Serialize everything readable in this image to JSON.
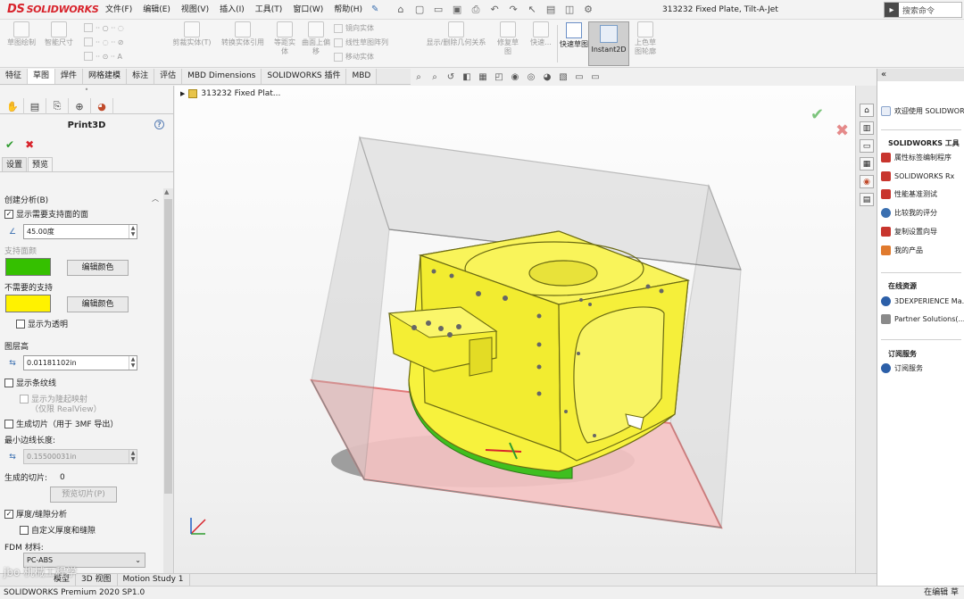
{
  "app": {
    "logo_text": "SOLIDWORKS",
    "document_title": "313232 Fixed Plate, Tilt-A-Jet",
    "search_placeholder": "搜索命令"
  },
  "menu": [
    "文件(F)",
    "编辑(E)",
    "视图(V)",
    "插入(I)",
    "工具(T)",
    "窗口(W)",
    "帮助(H)"
  ],
  "commands": {
    "sketch": "草图绘制",
    "smart_dim": "智能尺寸",
    "trim": "剪裁实体(T)",
    "convert": "转换实体引用",
    "offset": "等距实体",
    "surface_offset": "曲面上偏移",
    "mirror": "镜向实体",
    "linear_pattern": "线性草图阵列",
    "move": "移动实体",
    "show_relations": "显示/删除几何关系",
    "repair": "修复草图",
    "quick_snap": "快速...",
    "rapid_sketch": "快速草图",
    "instant2d": "Instant2D",
    "shaded_sketch": "上色草图轮廓"
  },
  "tabs": [
    "特征",
    "草图",
    "焊件",
    "网格建模",
    "标注",
    "评估",
    "MBD Dimensions",
    "SOLIDWORKS 插件",
    "MBD"
  ],
  "active_tab_index": 1,
  "property_manager": {
    "title": "Print3D",
    "subtabs": [
      "设置",
      "预览"
    ],
    "active_subtab_index": 1,
    "create_analysis_title": "创建分析(B)",
    "show_support_faces": "显示需要支持面的面",
    "angle_value": "45.00度",
    "support_faces_label": "支持面颜",
    "edit_color_label": "编辑颜色",
    "no_support_label": "不需要的支持",
    "show_transparent": "显示为透明",
    "layer_height_title": "图层高",
    "layer_height_value": "0.01181102in",
    "show_stripes": "显示条纹线",
    "show_as_bump": "显示为隆起映射",
    "realview_note": "（仅限 RealView）",
    "generate_slices": "生成切片（用于 3MF 导出）",
    "min_edge_title": "最小边线长度:",
    "min_edge_value": "0.15500031in",
    "slices_label": "生成的切片:",
    "slices_count": "0",
    "preview_slices_btn": "预览切片(P)",
    "thickness_analysis": "厚度/缝隙分析",
    "custom_thickness": "自定义厚度和缝隙",
    "fdm_material_label": "FDM 材料:",
    "fdm_material_value": "PC-ABS",
    "support_color": "#35c000",
    "no_support_color": "#fff200"
  },
  "viewport": {
    "tree_label": "313232 Fixed Plat...",
    "part_color": "#f7f23d",
    "support_face_color": "#3fbf1f",
    "build_plate_color": "#f3b2b2"
  },
  "taskpane": {
    "welcome": "欢迎使用 SOLIDWORKS",
    "tools_title": "SOLIDWORKS 工具",
    "tools": [
      "属性标签编制程序",
      "SOLIDWORKS Rx",
      "性能基准测试",
      "比较我的评分",
      "复制设置向导",
      "我的产品"
    ],
    "online_title": "在线资源",
    "online": [
      "3DEXPERIENCE Ma...",
      "Partner Solutions(..."
    ],
    "subscription_title": "订阅服务",
    "subscription": [
      "订阅服务"
    ]
  },
  "bottom_tabs": [
    "模型",
    "3D 视图",
    "Motion Study 1"
  ],
  "status": {
    "left": "SOLIDWORKS Premium 2020 SP1.0",
    "right": "在编辑 草"
  },
  "watermark": "jbo 机械工程学"
}
